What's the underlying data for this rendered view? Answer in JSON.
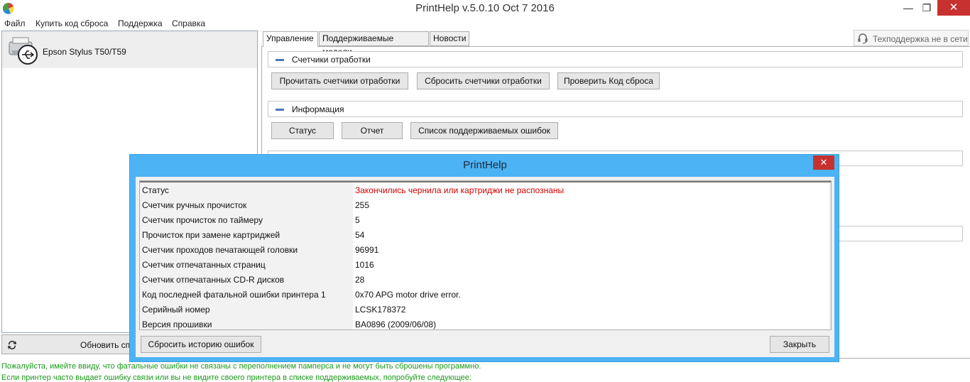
{
  "window": {
    "title": "PrintHelp v.5.0.10 Oct  7 2016",
    "min": "—",
    "max": "❐",
    "close": "✕"
  },
  "menu": [
    "Файл",
    "Купить код сброса",
    "Поддержка",
    "Справка"
  ],
  "left_panel": {
    "device": "Epson Stylus T50/T59",
    "refresh_label": "Обновить сп"
  },
  "tabs": [
    "Управление",
    "Поддерживаемые модели",
    "Новости"
  ],
  "support": {
    "label": "Техподдержка не в сети"
  },
  "sections": {
    "counters": {
      "title": "Счетчики отработки",
      "buttons": [
        "Прочитать счетчики отработки",
        "Сбросить счетчики отработки",
        "Проверить Код сброса"
      ]
    },
    "info": {
      "title": "Информация",
      "buttons": [
        "Статус",
        "Отчет",
        "Список поддерживаемых ошибок"
      ]
    }
  },
  "status_lines": [
    "Пожалуйста, имейте ввиду, что фатальные ошибки не связаны с переполнением памперса и не могут быть сброшены программно.",
    "Если принтер часто выдает ошибку связи или вы не видите своего принтера в списке поддерживаемых, попробуйте следующее:"
  ],
  "colors": {
    "status_text": "#1a9a1a",
    "dialog_frame": "#4cb3f5",
    "error_text": "#d00000"
  },
  "dialog": {
    "title": "PrintHelp",
    "close": "✕",
    "rows": [
      {
        "key": "Статус",
        "value": "Закончились чернила или картриджи не распознаны",
        "error": true
      },
      {
        "key": "Счетчик ручных прочисток",
        "value": "255"
      },
      {
        "key": "Счетчик прочисток по таймеру",
        "value": "5"
      },
      {
        "key": "Прочисток при замене картриджей",
        "value": "54"
      },
      {
        "key": "Счетчик проходов печатающей головки",
        "value": "96991"
      },
      {
        "key": "Счетчик отпечатанных страниц",
        "value": "1016"
      },
      {
        "key": "Счетчик отпечатанных CD-R дисков",
        "value": "28"
      },
      {
        "key": "Код последней фатальной ошибки принтера 1",
        "value": "0x70 APG motor drive error."
      },
      {
        "key": "Серийный номер",
        "value": "LCSK178372"
      },
      {
        "key": "Версия прошивки",
        "value": "BA0896 (2009/06/08)"
      }
    ],
    "reset_history": "Сбросить историю ошибок",
    "close_button": "Закрыть"
  }
}
